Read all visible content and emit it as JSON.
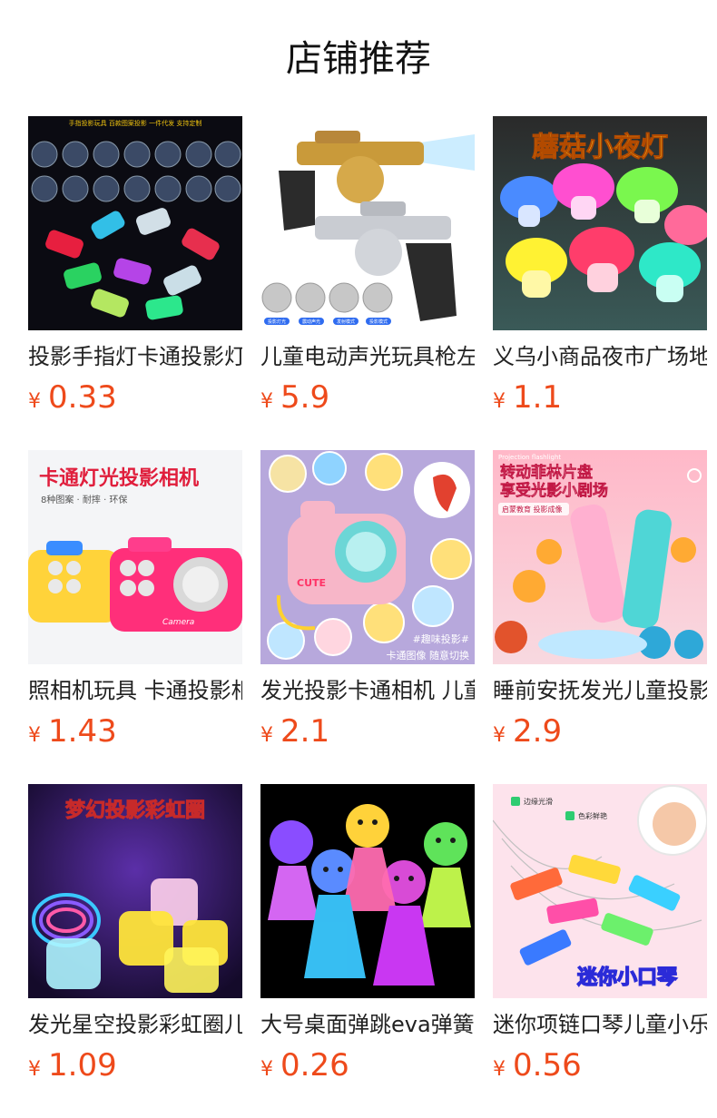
{
  "page_title": "店铺推荐",
  "currency_symbol": "¥",
  "products": [
    {
      "name": "投影手指灯卡通投影灯",
      "price": "0.33",
      "image_icon": "finger-projector-light-image",
      "image_text": [
        "手指投影玩具 百款图案投影 一件代发 支持定制"
      ]
    },
    {
      "name": "儿童电动声光玩具枪左轮",
      "price": "5.9",
      "image_icon": "toy-gun-image",
      "image_text": [
        "投影灯光",
        "震动声光",
        "发射模式",
        "投影模式"
      ]
    },
    {
      "name": "义乌小商品夜市广场地摊",
      "price": "1.1",
      "image_icon": "mushroom-night-light-image",
      "image_text": [
        "蘑菇小夜灯"
      ]
    },
    {
      "name": "照相机玩具 卡通投影相机",
      "price": "1.43",
      "image_icon": "toy-camera-image",
      "image_text": [
        "卡通灯光投影相机",
        "8种图案 · 耐摔 · 环保",
        "Camera"
      ]
    },
    {
      "name": "发光投影卡通相机 儿童",
      "price": "2.1",
      "image_icon": "pink-projection-camera-image",
      "image_text": [
        "#趣味投影#",
        "卡通图像 随意切换",
        "CUTE"
      ]
    },
    {
      "name": "睡前安抚发光儿童投影",
      "price": "2.9",
      "image_icon": "projection-flashlight-image",
      "image_text": [
        "Projection flashlight",
        "转动菲林片盘",
        "享受光影小剧场",
        "启蒙教育 投影成像"
      ]
    },
    {
      "name": "发光星空投影彩虹圈儿童",
      "price": "1.09",
      "image_icon": "rainbow-spring-image",
      "image_text": [
        "梦幻投影彩虹圈"
      ]
    },
    {
      "name": "大号桌面弹跳eva弹簧人",
      "price": "0.26",
      "image_icon": "bouncing-emoji-toy-image",
      "image_text": []
    },
    {
      "name": "迷你项链口琴儿童小乐器",
      "price": "0.56",
      "image_icon": "mini-harmonica-necklace-image",
      "image_text": [
        "边缘光滑",
        "色彩鲜艳",
        "迷你小口琴"
      ]
    }
  ]
}
